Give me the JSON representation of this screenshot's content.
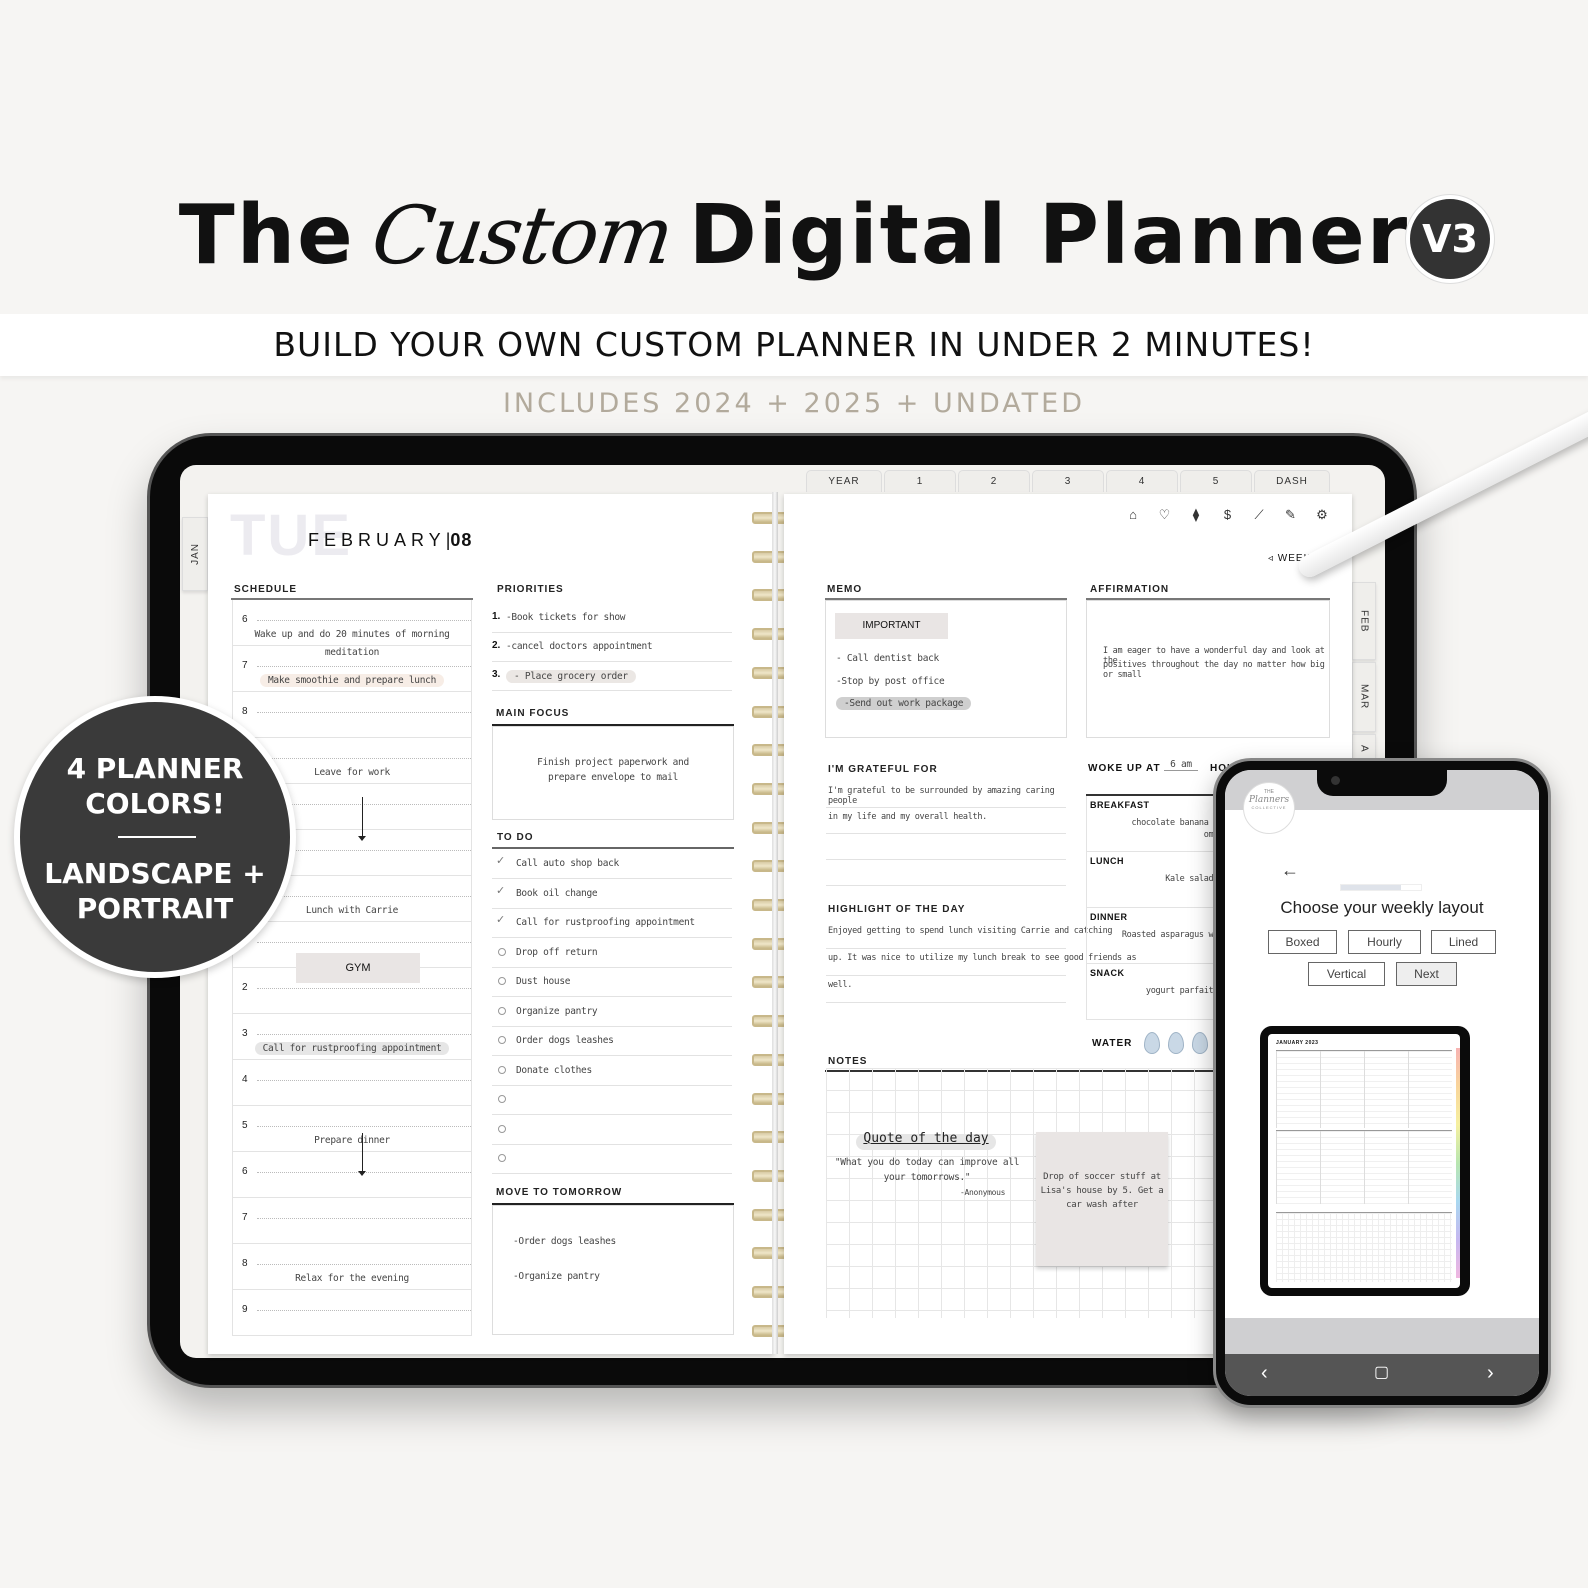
{
  "header": {
    "title_prefix": "The",
    "title_script": "Custom",
    "title_suffix": "Digital Planner",
    "version_badge": "V3",
    "tagline": "BUILD YOUR OWN CUSTOM PLANNER IN UNDER 2 MINUTES!",
    "includes": "INCLUDES 2024 + 2025 + UNDATED"
  },
  "badge": {
    "line1": "4 PLANNER",
    "line2": "COLORS!",
    "line3": "LANDSCAPE +",
    "line4": "PORTRAIT"
  },
  "tabs": {
    "top": [
      "YEAR",
      "1",
      "2",
      "3",
      "4",
      "5",
      "DASH"
    ],
    "left": [
      "JAN"
    ],
    "right": [
      "FEB",
      "MAR",
      "A"
    ]
  },
  "toolbar": {
    "icons": [
      "home-icon",
      "heart-icon",
      "dumbbell-icon",
      "dollar-icon",
      "chart-icon",
      "pencil-icon",
      "gear-icon"
    ],
    "glyphs": [
      "⌂",
      "♡",
      "⧫",
      "$",
      "⟋",
      "✎",
      "⚙"
    ],
    "week_link": "◃ WEEK"
  },
  "day": {
    "weekday": "TUE",
    "month": "FEBRUARY",
    "date": "08"
  },
  "schedule": {
    "title": "SCHEDULE",
    "rows": [
      {
        "hour": "6",
        "text": "Wake up and do 20 minutes of morning meditation",
        "highlight": ""
      },
      {
        "hour": "7",
        "text": "Make smoothie and prepare lunch",
        "highlight": "peach"
      },
      {
        "hour": "8",
        "text": "",
        "highlight": ""
      },
      {
        "hour": "",
        "text": "Leave for work",
        "highlight": ""
      },
      {
        "hour": "",
        "text": "",
        "highlight": ""
      },
      {
        "hour": "",
        "text": "",
        "highlight": ""
      },
      {
        "hour": "",
        "text": "Lunch with Carrie",
        "highlight": ""
      },
      {
        "hour": "",
        "text": "",
        "highlight": ""
      },
      {
        "hour": "2",
        "text": "",
        "highlight": ""
      },
      {
        "hour": "3",
        "text": "Call for rustproofing appointment",
        "highlight": "grey"
      },
      {
        "hour": "4",
        "text": "",
        "highlight": ""
      },
      {
        "hour": "5",
        "text": "Prepare dinner",
        "highlight": ""
      },
      {
        "hour": "6",
        "text": "",
        "highlight": ""
      },
      {
        "hour": "7",
        "text": "",
        "highlight": ""
      },
      {
        "hour": "8",
        "text": "Relax for the evening",
        "highlight": ""
      },
      {
        "hour": "9",
        "text": "",
        "highlight": ""
      }
    ],
    "sticker": "GYM"
  },
  "priorities": {
    "title": "PRIORITIES",
    "items": [
      {
        "num": "1.",
        "text": "-Book tickets for show"
      },
      {
        "num": "2.",
        "text": "-cancel doctors appointment"
      },
      {
        "num": "3.",
        "text": "- Place grocery order"
      }
    ]
  },
  "main_focus": {
    "title": "MAIN FOCUS",
    "text_line1": "Finish project paperwork and",
    "text_line2": "prepare envelope to mail"
  },
  "todo": {
    "title": "TO DO",
    "items": [
      {
        "text": "Call auto shop back",
        "done": true
      },
      {
        "text": "Book oil change",
        "done": true
      },
      {
        "text": "Call for rustproofing appointment",
        "done": true
      },
      {
        "text": "Drop off return",
        "done": false
      },
      {
        "text": "Dust house",
        "done": false
      },
      {
        "text": "Organize pantry",
        "done": false
      },
      {
        "text": "Order dogs leashes",
        "done": false
      },
      {
        "text": "Donate clothes",
        "done": false
      },
      {
        "text": "",
        "done": false
      },
      {
        "text": "",
        "done": false
      },
      {
        "text": "",
        "done": false
      }
    ]
  },
  "move_to_tomorrow": {
    "title": "MOVE TO TOMORROW",
    "items": [
      "-Order dogs leashes",
      "-Organize pantry"
    ]
  },
  "memo": {
    "title": "MEMO",
    "sticker": "IMPORTANT",
    "items": [
      "- Call dentist back",
      "-Stop by post office",
      "-Send out work package"
    ]
  },
  "affirmation": {
    "title": "AFFIRMATION",
    "line1": "I am eager to have a wonderful day and look at the",
    "line2": "positives throughout the day no matter how big or small"
  },
  "grateful": {
    "title": "I'M GRATEFUL FOR",
    "lines": [
      "I'm grateful to be surrounded by amazing caring people",
      "in my life and my overall health.",
      "",
      ""
    ]
  },
  "highlight": {
    "title": "HIGHLIGHT OF THE DAY",
    "lines": [
      "Enjoyed getting to spend lunch visiting Carrie and catching",
      "up. It was nice to utilize my lunch break to see good friends as",
      "well."
    ]
  },
  "woke_up": {
    "label": "WOKE UP AT",
    "value": "6 am",
    "next_label": "HOU"
  },
  "meals": [
    {
      "label": "BREAKFAST",
      "value": "chocolate banana sm",
      "value2": "omel"
    },
    {
      "label": "LUNCH",
      "value": "Kale salad a",
      "value2": ""
    },
    {
      "label": "DINNER",
      "value": "Roasted asparagus wit",
      "value2": ""
    },
    {
      "label": "SNACK",
      "value": "yogurt parfait a",
      "value2": ""
    }
  ],
  "water": {
    "label": "WATER",
    "drops_visible": 3
  },
  "notes": {
    "title": "NOTES",
    "quote_title": "Quote of the day",
    "quote_line1": "\"What you do today can improve all",
    "quote_line2": "your tomorrows.\"",
    "quote_author": "-Anonymous",
    "sticky_line1": "Drop of soccer stuff at",
    "sticky_line2": "Lisa's house by 5. Get a",
    "sticky_line3": "car wash after"
  },
  "phone": {
    "logo_top": "THE",
    "logo_mid": "Planners",
    "logo_bottom": "COLLECTIVE",
    "back_arrow": "←",
    "progress": 0.75,
    "heading": "Choose your weekly layout",
    "options": [
      "Boxed",
      "Hourly",
      "Lined",
      "Vertical"
    ],
    "next": "Next",
    "preview_title": "JANUARY 2023",
    "nav": [
      "‹",
      "▢",
      "›"
    ]
  }
}
